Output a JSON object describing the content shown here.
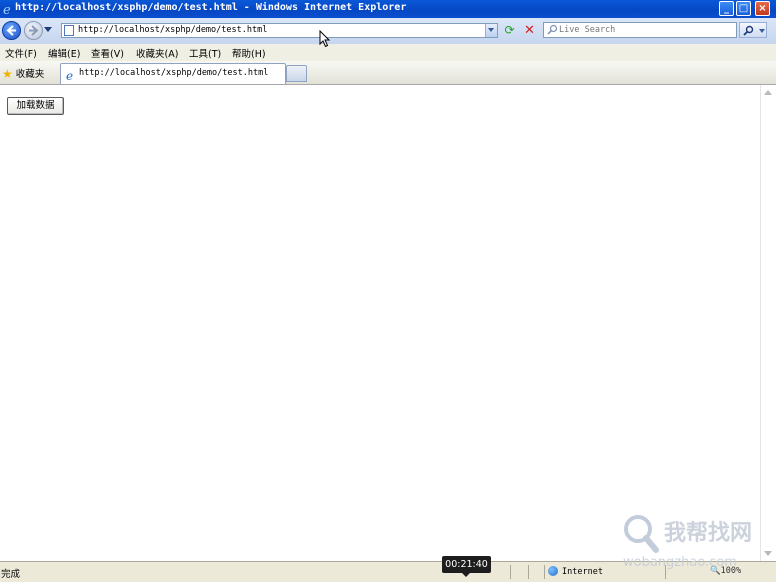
{
  "window": {
    "title": "http://localhost/xsphp/demo/test.html - Windows Internet Explorer"
  },
  "address_bar": {
    "url": "http://localhost/xsphp/demo/test.html"
  },
  "search": {
    "placeholder": "Live Search"
  },
  "menu": {
    "items": [
      {
        "label": "文件(F)"
      },
      {
        "label": "编辑(E)"
      },
      {
        "label": "查看(V)"
      },
      {
        "label": "收藏夹(A)"
      },
      {
        "label": "工具(T)"
      },
      {
        "label": "帮助(H)"
      }
    ]
  },
  "favorites_bar": {
    "label": "收藏夹"
  },
  "tab": {
    "label": "http://localhost/xsphp/demo/test.html"
  },
  "page": {
    "load_button_label": "加载数据"
  },
  "status_bar": {
    "status": "完成",
    "zone": "Internet",
    "zoom": "100%"
  },
  "overlay": {
    "timestamp": "00:21:40",
    "watermark_text": "我帮找网",
    "watermark_domain": "wobangzhao.com"
  }
}
